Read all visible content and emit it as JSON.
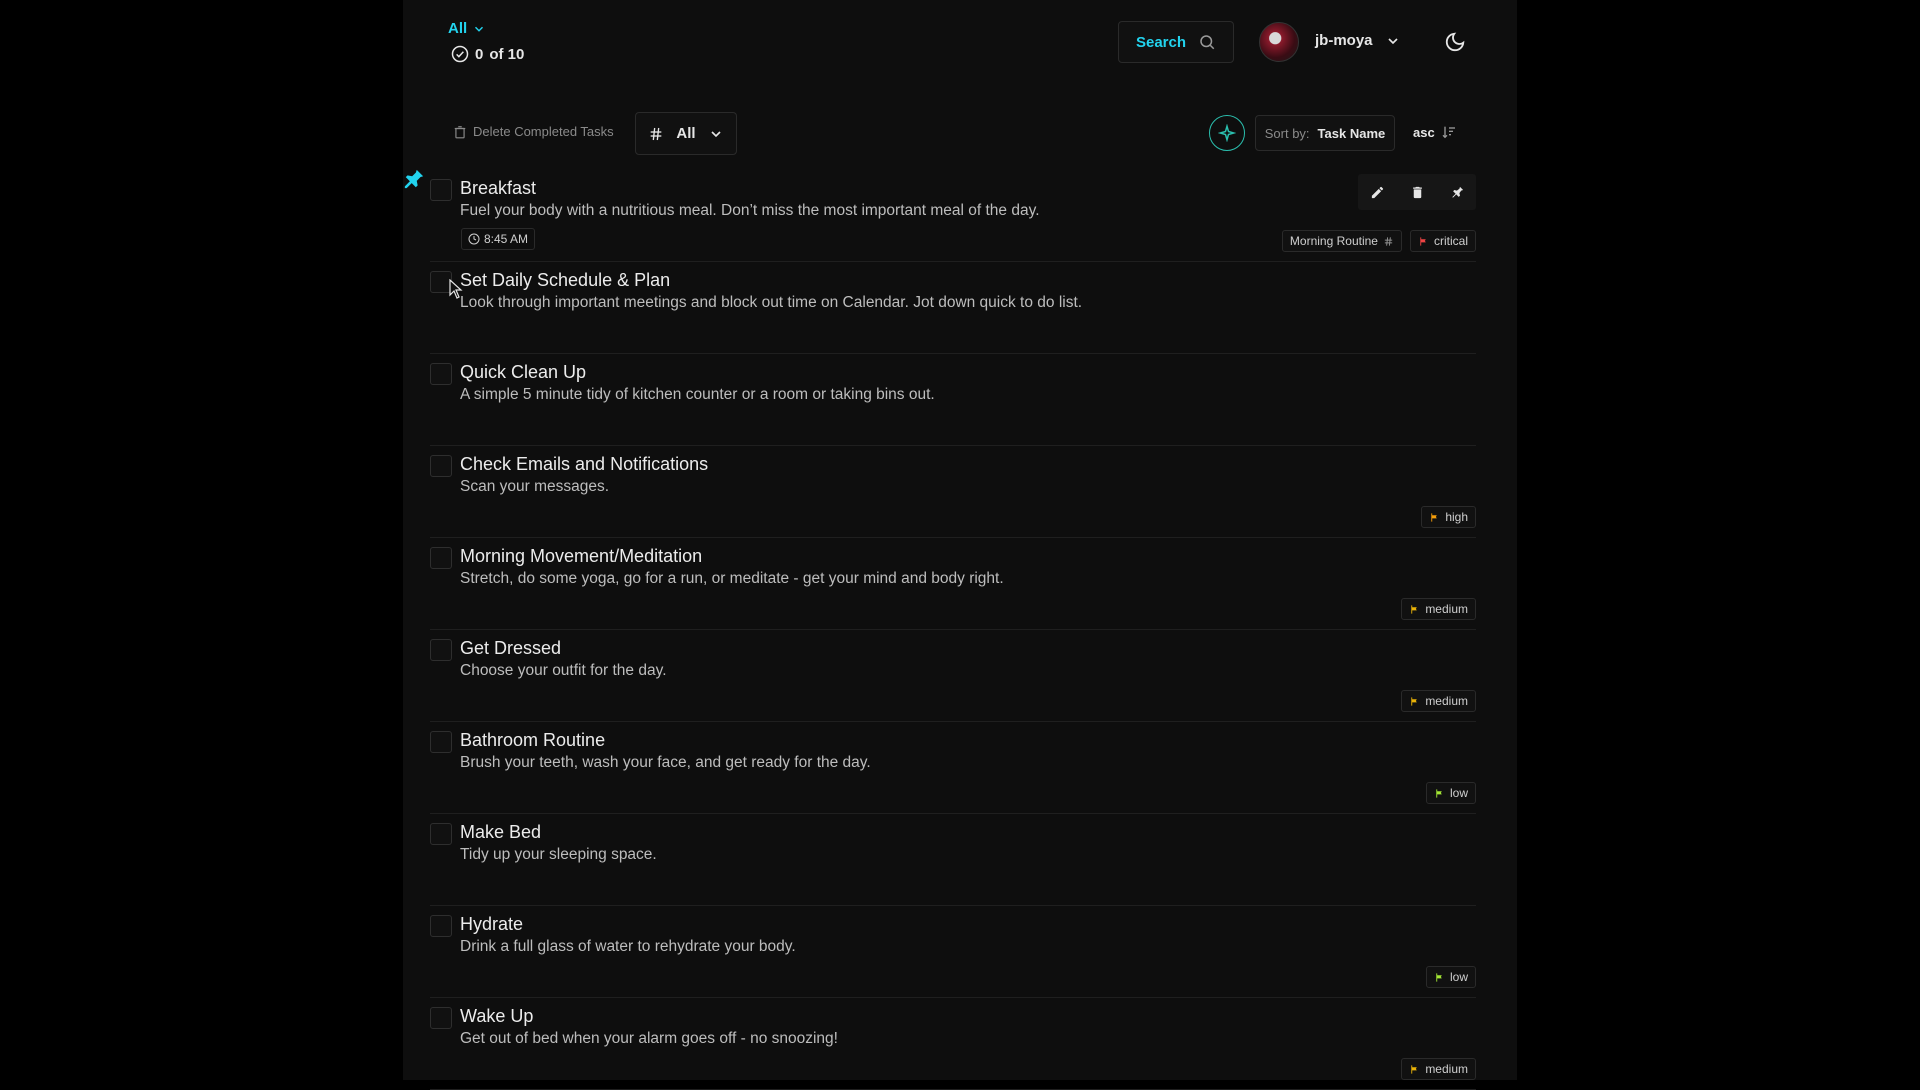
{
  "header": {
    "filter_label": "All",
    "progress_completed": "0",
    "progress_text": "of 10",
    "search_label": "Search",
    "username": "jb-moya"
  },
  "toolbar": {
    "delete_completed_label": "Delete Completed Tasks",
    "tag_filter_value": "All",
    "sort_label": "Sort by:",
    "sort_value": "Task Name",
    "sort_direction": "asc"
  },
  "priority_colors": {
    "critical": "#ef4444",
    "high": "#f59e0b",
    "medium": "#eab308",
    "low": "#a3e635"
  },
  "accent_color": "#22d3ee",
  "tasks": [
    {
      "title": "Breakfast",
      "description": "Fuel your body with a nutritious meal. Don’t miss the most important meal of the day.",
      "time": "8:45 AM",
      "tag": "Morning Routine",
      "priority": "critical",
      "pinned": true
    },
    {
      "title": "Set Daily Schedule & Plan",
      "description": "Look through important meetings and block out time on Calendar. Jot down quick to do list."
    },
    {
      "title": "Quick Clean Up",
      "description": "A simple 5 minute tidy of kitchen counter or a room or taking bins out."
    },
    {
      "title": "Check Emails and Notifications",
      "description": "Scan your messages.",
      "priority": "high"
    },
    {
      "title": "Morning Movement/Meditation",
      "description": "Stretch, do some yoga, go for a run, or meditate - get your mind and body right.",
      "priority": "medium"
    },
    {
      "title": "Get Dressed",
      "description": "Choose your outfit for the day.",
      "priority": "medium"
    },
    {
      "title": "Bathroom Routine",
      "description": "Brush your teeth, wash your face, and get ready for the day.",
      "priority": "low"
    },
    {
      "title": "Make Bed",
      "description": "Tidy up your sleeping space."
    },
    {
      "title": "Hydrate",
      "description": "Drink a full glass of water to rehydrate your body.",
      "priority": "low"
    },
    {
      "title": "Wake Up",
      "description": "Get out of bed when your alarm goes off - no snoozing!",
      "priority": "medium"
    }
  ],
  "icons": {
    "filter_chevron": "chevron-down-icon",
    "progress": "check-circle-icon",
    "search": "search-icon",
    "theme": "moon-icon",
    "delete": "trash-icon",
    "tag": "hash-icon",
    "ai": "sparkle-icon",
    "sort": "sort-icon",
    "pin": "pin-icon",
    "edit": "pencil-icon",
    "priority": "flag-icon",
    "time": "clock-icon"
  }
}
